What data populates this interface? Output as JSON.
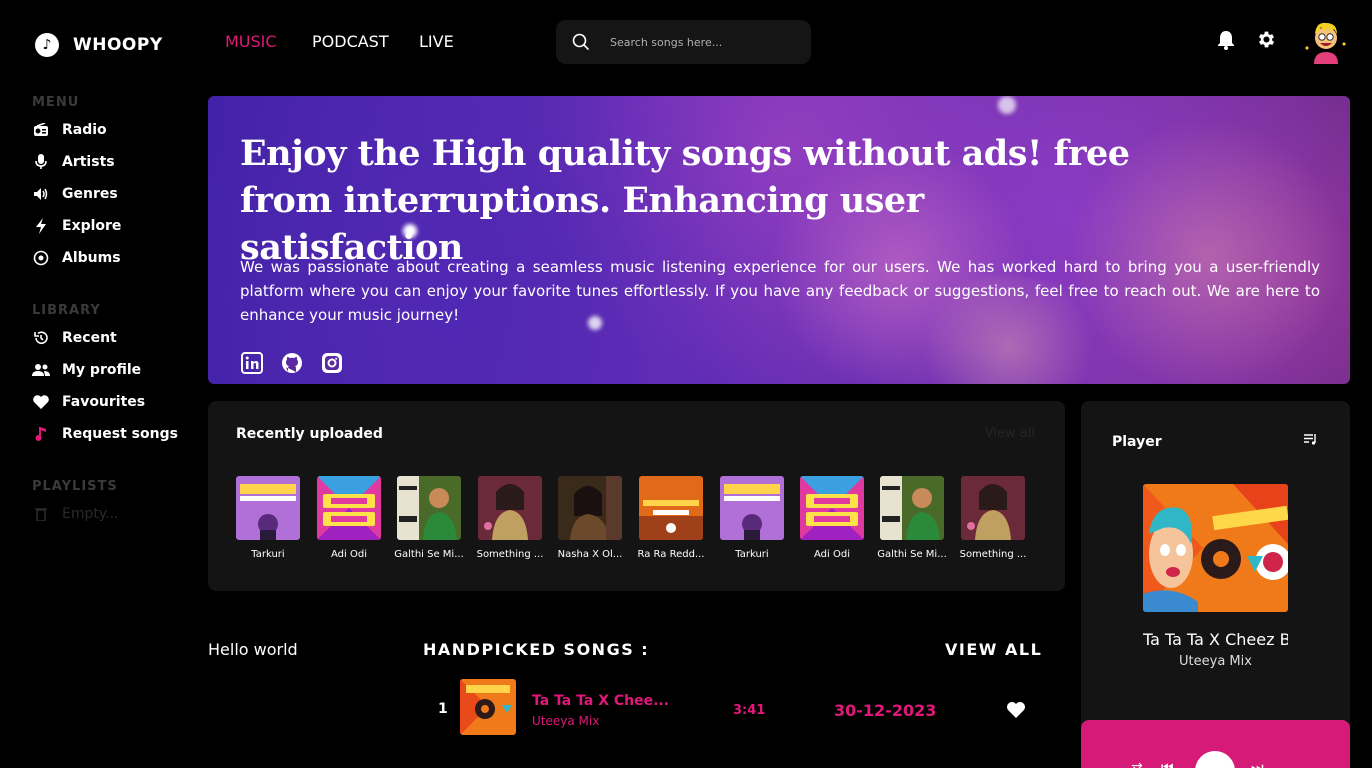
{
  "brand": {
    "name": "WHOOPY"
  },
  "sidebar": {
    "menu_title": "MENU",
    "menu": [
      {
        "label": "Radio",
        "icon": "radio-icon"
      },
      {
        "label": "Artists",
        "icon": "microphone-icon"
      },
      {
        "label": "Genres",
        "icon": "speaker-icon"
      },
      {
        "label": "Explore",
        "icon": "bolt-icon"
      },
      {
        "label": "Albums",
        "icon": "disc-icon"
      }
    ],
    "library_title": "LIBRARY",
    "library": [
      {
        "label": "Recent",
        "icon": "history-icon"
      },
      {
        "label": "My profile",
        "icon": "users-icon"
      },
      {
        "label": "Favourites",
        "icon": "heart-icon"
      },
      {
        "label": "Request songs",
        "icon": "music-note-icon"
      }
    ],
    "playlists_title": "PLAYLISTS",
    "playlists_empty": "Empty..."
  },
  "topnav": {
    "tabs": [
      {
        "label": "MUSIC",
        "active": true
      },
      {
        "label": "PODCAST",
        "active": false
      },
      {
        "label": "LIVE",
        "active": false
      }
    ],
    "search_placeholder": "Search songs here..."
  },
  "hero": {
    "headline": "Enjoy the High quality songs without ads! free from interruptions. Enhancing user satisfaction",
    "body": "We was passionate about creating a seamless music listening experience for our users. We has worked hard to bring you a user-friendly platform where you can enjoy your favorite tunes effortlessly. If you have any feedback or suggestions, feel free to reach out. We are here to enhance your music journey!",
    "socials": [
      "linkedin-icon",
      "github-icon",
      "instagram-icon"
    ]
  },
  "recent": {
    "title": "Recently uploaded",
    "view_all": "View all",
    "items": [
      {
        "caption": "Tarkuri",
        "style": "purple"
      },
      {
        "caption": "Adi Odi",
        "style": "neon"
      },
      {
        "caption": "Galthi Se Mi...",
        "style": "green"
      },
      {
        "caption": "Something ...",
        "style": "rose"
      },
      {
        "caption": "Nasha X Ol...",
        "style": "brown"
      },
      {
        "caption": "Ra Ra Redd...",
        "style": "orange"
      },
      {
        "caption": "Tarkuri",
        "style": "purple"
      },
      {
        "caption": "Adi Odi",
        "style": "neon"
      },
      {
        "caption": "Galthi Se Mi...",
        "style": "green"
      },
      {
        "caption": "Something ...",
        "style": "rose"
      }
    ]
  },
  "hello": "Hello world",
  "handpicked": {
    "title": "HANDPICKED SONGS :",
    "view_all": "VIEW ALL",
    "rows": [
      {
        "num": "1",
        "title": "Ta Ta Ta X Chee...",
        "artist": "Uteeya Mix",
        "duration": "3:41",
        "date": "30-12-2023"
      }
    ]
  },
  "player": {
    "title": "Player",
    "now_title": "Ta Ta Ta X Cheez B",
    "now_artist": "Uteeya Mix"
  },
  "colors": {
    "accent": "#e0187a",
    "panel": "#141414",
    "controls": "#d61a78"
  }
}
